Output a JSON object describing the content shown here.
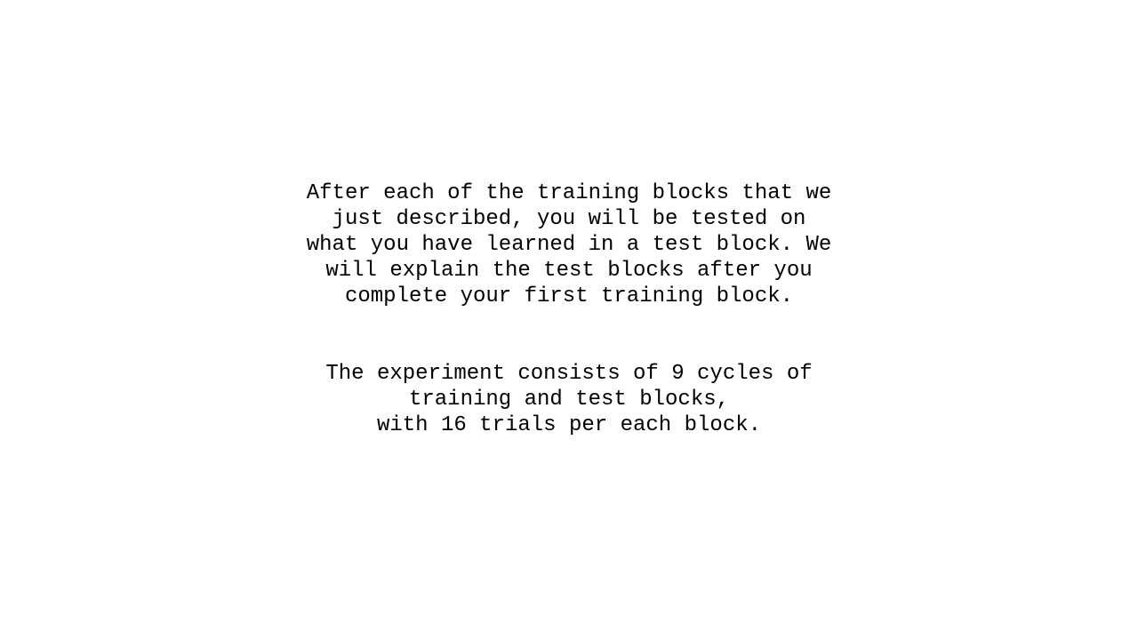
{
  "instructions": {
    "paragraph_1": [
      "After each of the training blocks that we",
      "just described, you will be tested on",
      "what you have learned in a test block. We",
      "will explain the test blocks after you",
      "complete your first training block."
    ],
    "paragraph_2": [
      "The experiment consists of 9 cycles of",
      "training and test blocks,",
      "with 16 trials per each block."
    ]
  }
}
